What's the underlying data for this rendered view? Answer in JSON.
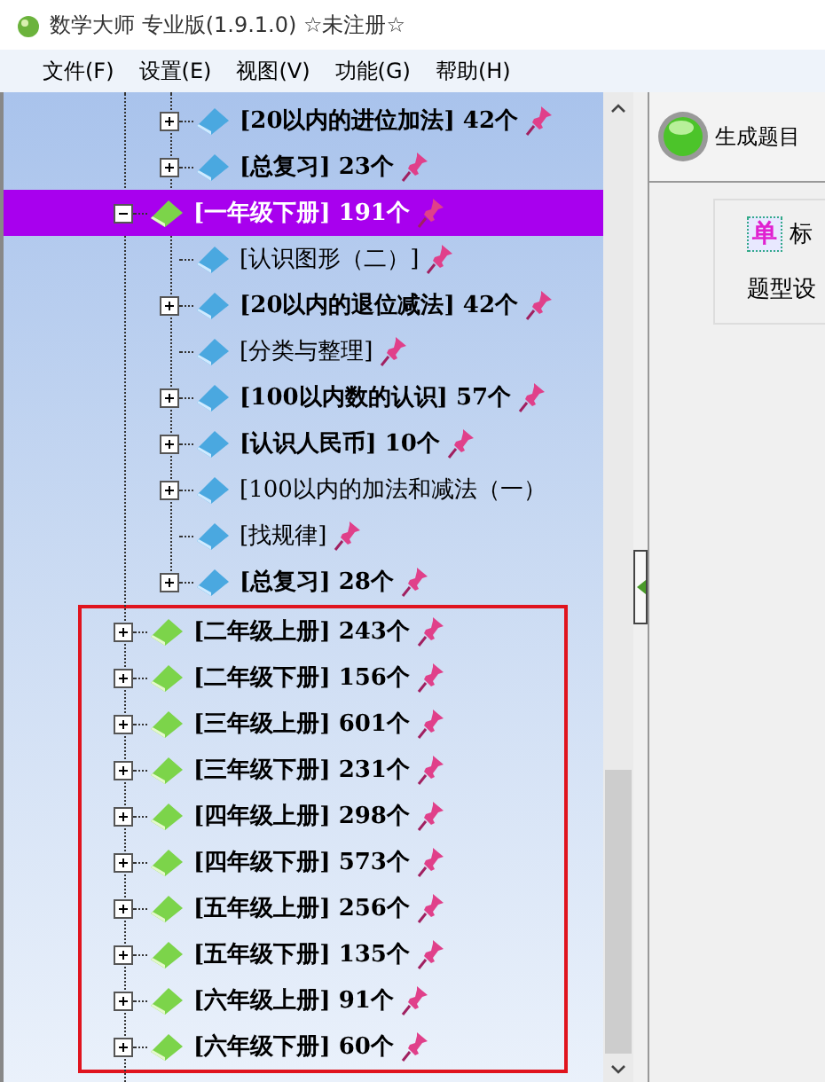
{
  "window": {
    "title": "数学大师 专业版(1.9.1.0) ☆未注册☆"
  },
  "menu": [
    "文件(F)",
    "设置(E)",
    "视图(V)",
    "功能(G)",
    "帮助(H)"
  ],
  "tree": {
    "leading_children": [
      {
        "kind": "node",
        "label": "[20以内的进位加法]",
        "count": "42个",
        "expanded": false
      },
      {
        "kind": "node",
        "label": "[总复习]",
        "count": "23个",
        "expanded": false
      }
    ],
    "items": [
      {
        "kind": "node",
        "label": "[一年级下册]",
        "count": "191个",
        "expanded": true,
        "selected": true,
        "highlighted": false,
        "children": [
          {
            "kind": "leaf",
            "label": "[认识图形（二）]"
          },
          {
            "kind": "node",
            "label": "[20以内的退位减法]",
            "count": "42个",
            "expanded": false
          },
          {
            "kind": "leaf",
            "label": "[分类与整理]"
          },
          {
            "kind": "node",
            "label": "[100以内数的认识]",
            "count": "57个",
            "expanded": false
          },
          {
            "kind": "node",
            "label": "[认识人民币]",
            "count": "10个",
            "expanded": false
          },
          {
            "kind": "node",
            "label": "[100以内的加法和减法（一）",
            "expanded": false
          },
          {
            "kind": "leaf",
            "label": "[找规律]"
          },
          {
            "kind": "node",
            "label": "[总复习]",
            "count": "28个",
            "expanded": false
          }
        ]
      },
      {
        "kind": "node",
        "label": "[二年级上册]",
        "count": "243个",
        "expanded": false,
        "selected": false,
        "highlighted": true
      },
      {
        "kind": "node",
        "label": "[二年级下册]",
        "count": "156个",
        "expanded": false,
        "selected": false,
        "highlighted": true
      },
      {
        "kind": "node",
        "label": "[三年级上册]",
        "count": "601个",
        "expanded": false,
        "selected": false,
        "highlighted": true
      },
      {
        "kind": "node",
        "label": "[三年级下册]",
        "count": "231个",
        "expanded": false,
        "selected": false,
        "highlighted": true
      },
      {
        "kind": "node",
        "label": "[四年级上册]",
        "count": "298个",
        "expanded": false,
        "selected": false,
        "highlighted": true
      },
      {
        "kind": "node",
        "label": "[四年级下册]",
        "count": "573个",
        "expanded": false,
        "selected": false,
        "highlighted": true
      },
      {
        "kind": "node",
        "label": "[五年级上册]",
        "count": "256个",
        "expanded": false,
        "selected": false,
        "highlighted": true
      },
      {
        "kind": "node",
        "label": "[五年级下册]",
        "count": "135个",
        "expanded": false,
        "selected": false,
        "highlighted": true
      },
      {
        "kind": "node",
        "label": "[六年级上册]",
        "count": "91个",
        "expanded": false,
        "selected": false,
        "highlighted": true
      },
      {
        "kind": "node",
        "label": "[六年级下册]",
        "count": "60个",
        "expanded": false,
        "selected": false,
        "highlighted": true
      }
    ]
  },
  "toolbar": {
    "generate_button": "生成题目"
  },
  "settings": {
    "badge": "单",
    "title": "标",
    "type_label": "题型设"
  }
}
